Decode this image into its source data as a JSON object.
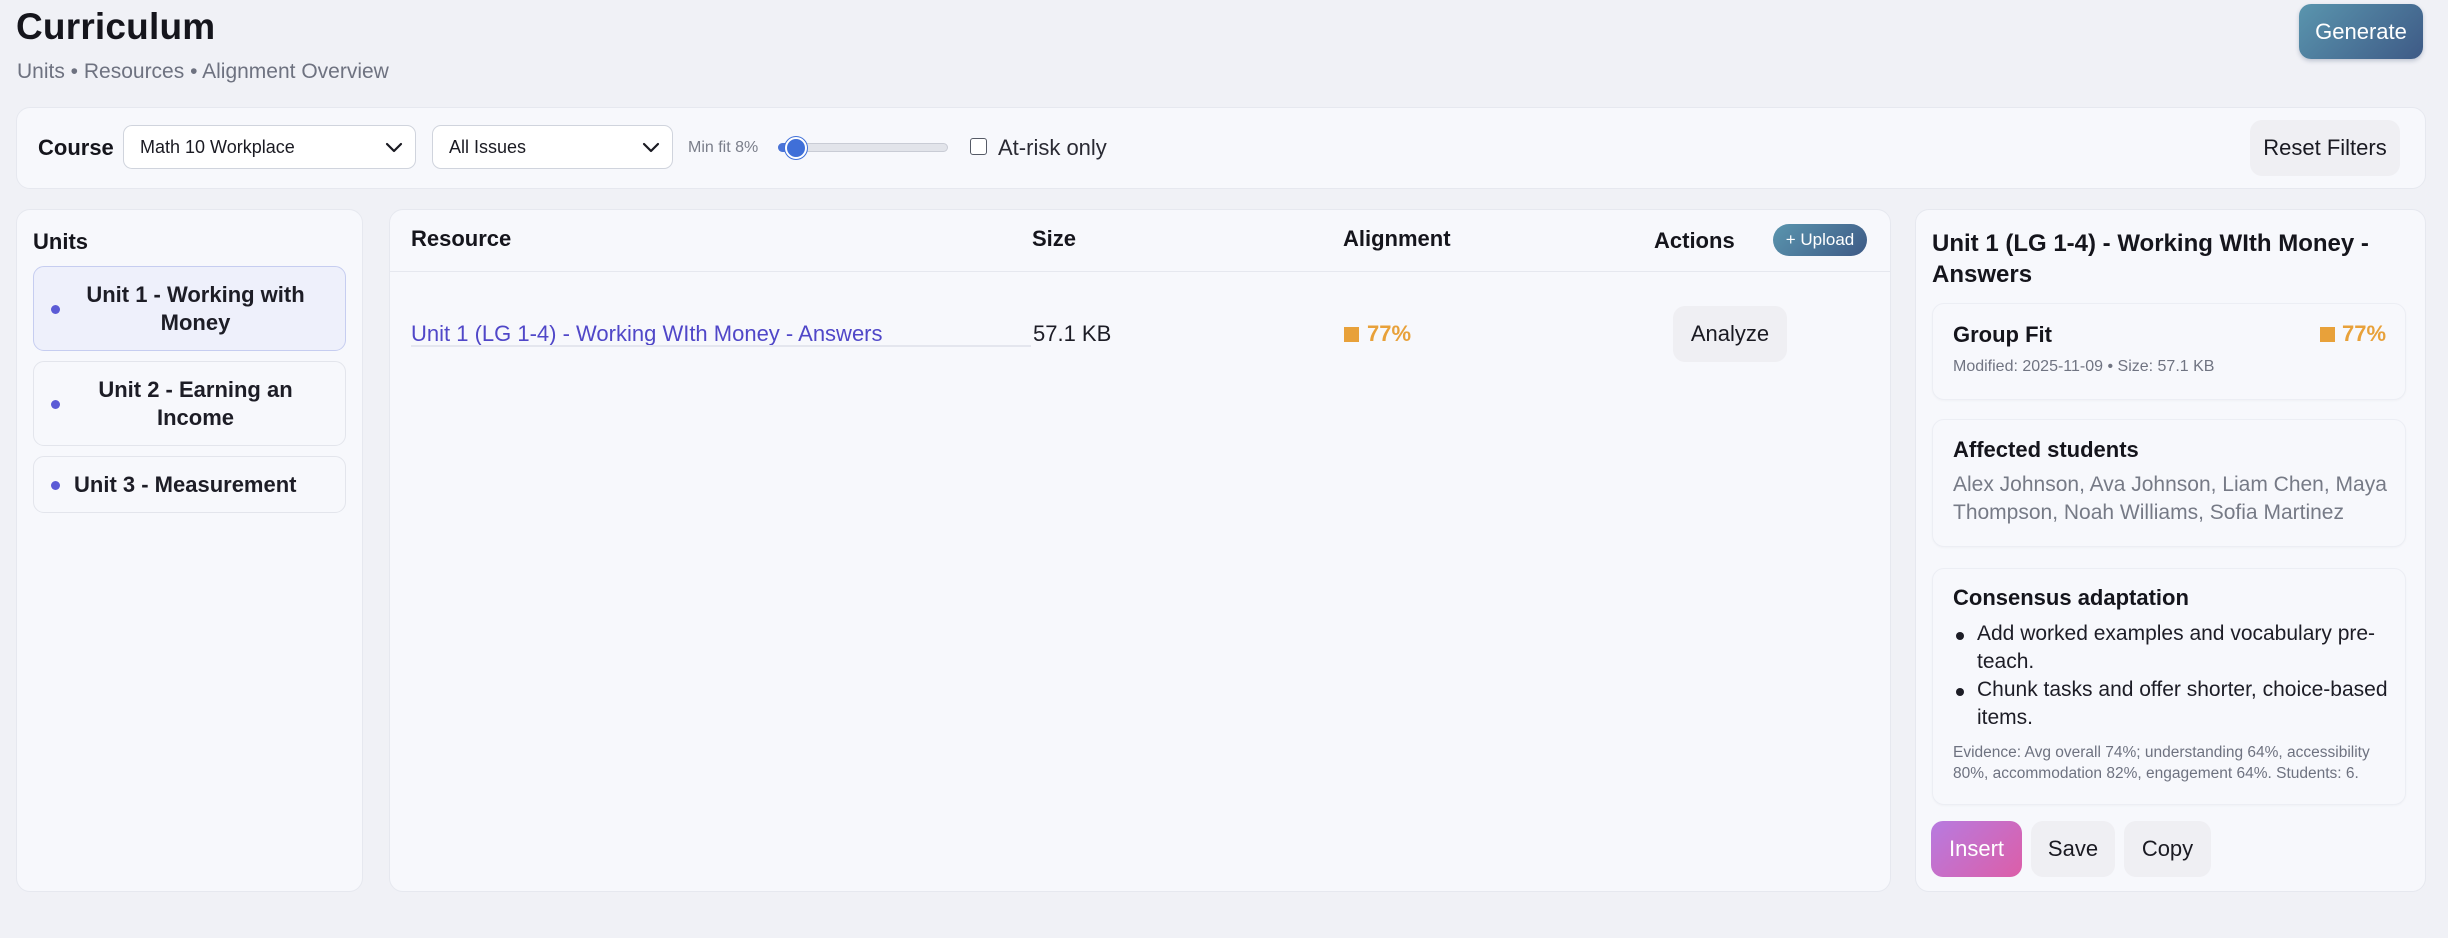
{
  "header": {
    "title": "Curriculum",
    "subtitle": "Units • Resources • Alignment Overview",
    "generate_label": "Generate"
  },
  "filters": {
    "course_label": "Course",
    "course_value": "Math 10 Workplace",
    "issues_value": "All Issues",
    "min_fit_label": "Min fit 8%",
    "min_fit_value": 0.08,
    "at_risk_label": "At-risk only",
    "at_risk_checked": false,
    "reset_label": "Reset Filters"
  },
  "units": {
    "heading": "Units",
    "items": [
      {
        "label": "Unit 1 - Working with Money",
        "selected": true
      },
      {
        "label": "Unit 2 - Earning an Income",
        "selected": false
      },
      {
        "label": "Unit 3 - Measurement",
        "selected": false
      }
    ]
  },
  "resources": {
    "columns": {
      "resource": "Resource",
      "size": "Size",
      "alignment": "Alignment",
      "actions": "Actions"
    },
    "upload_label": "+ Upload",
    "rows": [
      {
        "name": "Unit 1 (LG 1-4) - Working WIth Money - Answers",
        "size": "57.1 KB",
        "alignment": "77%",
        "action": "Analyze"
      }
    ]
  },
  "detail": {
    "title": "Unit 1 (LG 1-4) - Working WIth Money - Answers",
    "group_fit_label": "Group Fit",
    "group_fit_value": "77%",
    "meta": "Modified: 2025-11-09 • Size: 57.1 KB",
    "affected_label": "Affected students",
    "affected_students": "Alex Johnson, Ava Johnson, Liam Chen, Maya Thompson, Noah Williams, Sofia Martinez",
    "consensus_label": "Consensus adaptation",
    "consensus_items": [
      "Add worked examples and vocabulary pre-teach.",
      "Chunk tasks and offer shorter, choice-based items."
    ],
    "evidence": "Evidence: Avg overall 74%; understanding 64%, accessibility 80%, accommodation 82%, engagement 64%. Students: 6.",
    "insert_label": "Insert",
    "save_label": "Save",
    "copy_label": "Copy"
  },
  "colors": {
    "accent": "#5047c8",
    "alignment_warning": "#e8a13a",
    "primary_gradient_start": "#5a95ae",
    "primary_gradient_end": "#3e5a86",
    "insert_gradient_start": "#b77be0",
    "insert_gradient_end": "#dc5ea8"
  },
  "icons": {
    "select_chevron": "chevron-down-icon",
    "unit_bullet": "dot-icon",
    "alignment_marker": "square-icon"
  }
}
